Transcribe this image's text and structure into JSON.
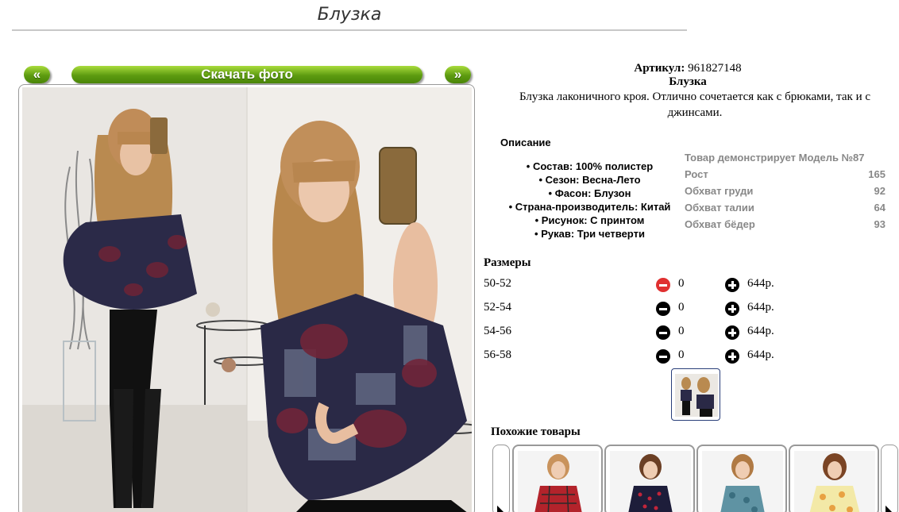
{
  "page": {
    "title": "Блузка"
  },
  "gallery": {
    "prev_label": "«",
    "next_label": "»",
    "download_label": "Скачать фото"
  },
  "product": {
    "sku_label": "Артикул:",
    "sku": "961827148",
    "name": "Блузка",
    "summary": "Блузка лаконичного кроя. Отлично сочетается как с брюками, так и с джинсами."
  },
  "description": {
    "heading": "Описание",
    "items": [
      "Состав: 100% полистер",
      "Сезон: Весна-Лето",
      "Фасон: Блузон",
      "Страна-производитель: Китай",
      "Рисунок: С принтом",
      "Рукав: Три четверти"
    ]
  },
  "model": {
    "heading": "Товар демонстрирует Модель №87",
    "rows": [
      {
        "label": "Рост",
        "value": "165"
      },
      {
        "label": "Обхват груди",
        "value": "92"
      },
      {
        "label": "Обхват талии",
        "value": "64"
      },
      {
        "label": "Обхват бёдер",
        "value": "93"
      }
    ]
  },
  "sizes": {
    "heading": "Размеры",
    "rows": [
      {
        "size": "50-52",
        "qty": "0",
        "price": "644р."
      },
      {
        "size": "52-54",
        "qty": "0",
        "price": "644р."
      },
      {
        "size": "54-56",
        "qty": "0",
        "price": "644р."
      },
      {
        "size": "56-58",
        "qty": "0",
        "price": "644р."
      }
    ]
  },
  "similar": {
    "heading": "Похожие товары",
    "prev_icon": "◣",
    "next_icon": "◣"
  },
  "colors": {
    "accent_green": "#5d9b10",
    "minus_active": "#e03030"
  }
}
